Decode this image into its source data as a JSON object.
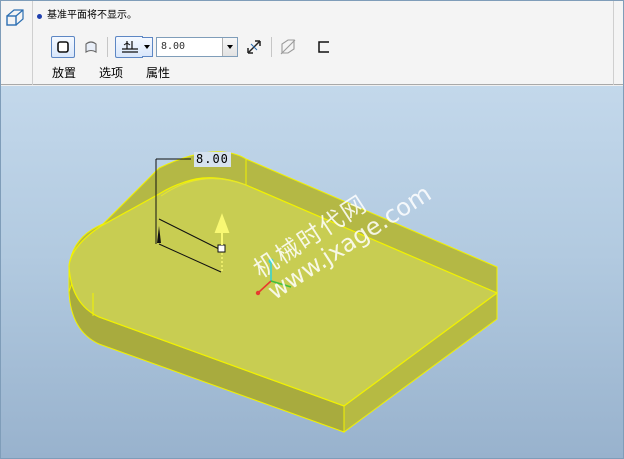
{
  "dashboard": {
    "message": "基准平面将不显示。",
    "tabs": [
      {
        "label": "放置"
      },
      {
        "label": "选项"
      },
      {
        "label": "属性"
      }
    ],
    "depth": {
      "value": "8.00"
    },
    "icons": [
      "extrude-feature-icon",
      "solid-icon",
      "surface-icon",
      "blind-depth-icon",
      "flip-direction-icon",
      "remove-material-icon",
      "thicken-icon"
    ]
  },
  "model": {
    "dimension": "8.00",
    "body_color": "#c8cd52",
    "edge_color": "#f2f200"
  },
  "watermark": {
    "line1": "机械时代网",
    "line2": "www.jxage.com"
  }
}
